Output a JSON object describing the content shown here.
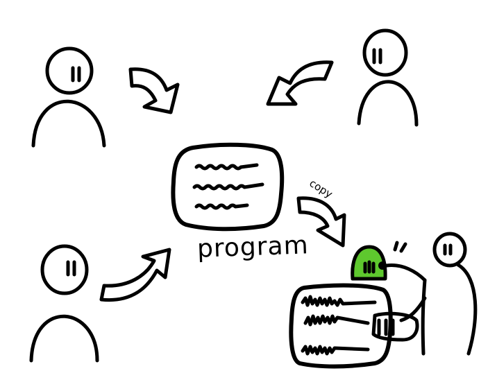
{
  "labels": {
    "program": "program",
    "copy": "copy"
  },
  "colors": {
    "ink": "#000000",
    "paper": "#ffffff",
    "copier_head": "#5ec82e"
  },
  "icons": {
    "person": "person-icon",
    "arrow": "curved-arrow-icon",
    "document": "document-icon"
  }
}
